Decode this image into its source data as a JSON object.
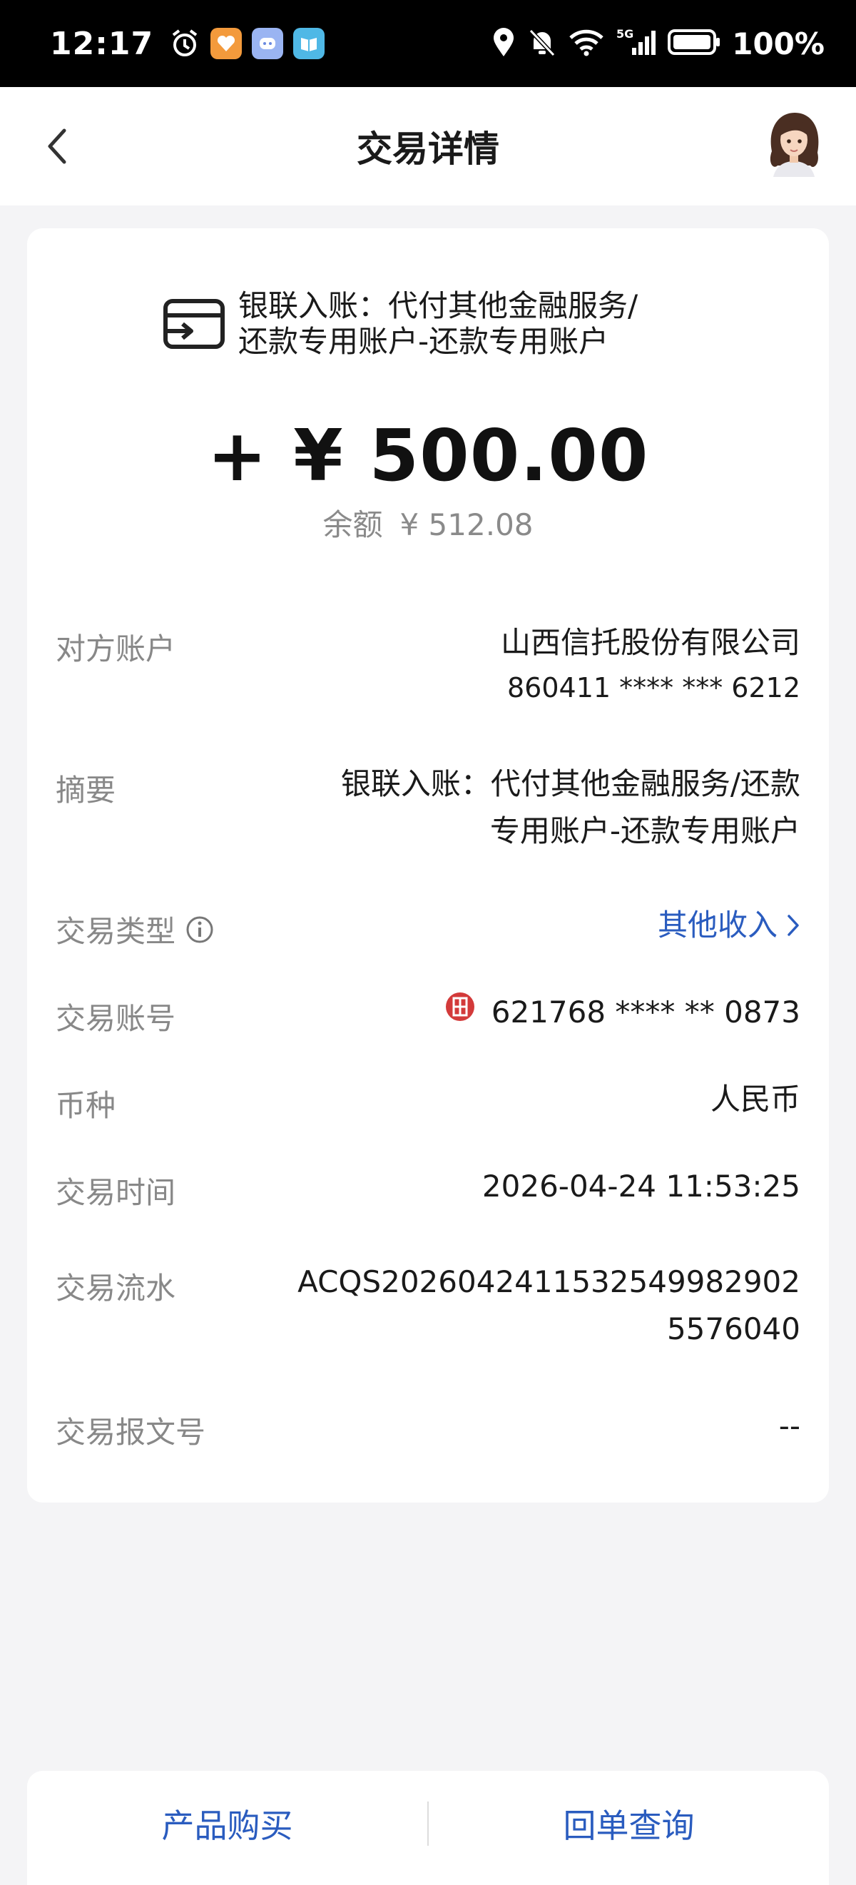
{
  "status_bar": {
    "time": "12:17",
    "battery": "100%",
    "network": "5G"
  },
  "header": {
    "title": "交易详情"
  },
  "transaction": {
    "title_line1": "银联入账：代付其他金融服务/",
    "title_line2": "还款专用账户-还款专用账户",
    "amount": "+ ¥ 500.00",
    "balance_label": "余额",
    "balance_value": "¥ 512.08"
  },
  "details": {
    "counterparty_label": "对方账户",
    "counterparty_name": "山西信托股份有限公司",
    "counterparty_account": "860411 **** *** 6212",
    "summary_label": "摘要",
    "summary_line1": "银联入账：代付其他金融服务/还款",
    "summary_line2": "专用账户-还款专用账户",
    "type_label": "交易类型",
    "type_value": "其他收入",
    "account_label": "交易账号",
    "account_value": "621768 **** ** 0873",
    "currency_label": "币种",
    "currency_value": "人民币",
    "time_label": "交易时间",
    "time_value": "2026-04-24 11:53:25",
    "serial_label": "交易流水",
    "serial_line1": "ACQS2026042411532549982902",
    "serial_line2": "5576040",
    "message_label": "交易报文号",
    "message_value": "--"
  },
  "bottom_bar": {
    "left_button": "产品购买",
    "right_button": "回单查询"
  },
  "colors": {
    "accent": "#2a5cbf",
    "label": "#888888",
    "background": "#f4f4f6",
    "bank_logo": "#d33a3a"
  }
}
